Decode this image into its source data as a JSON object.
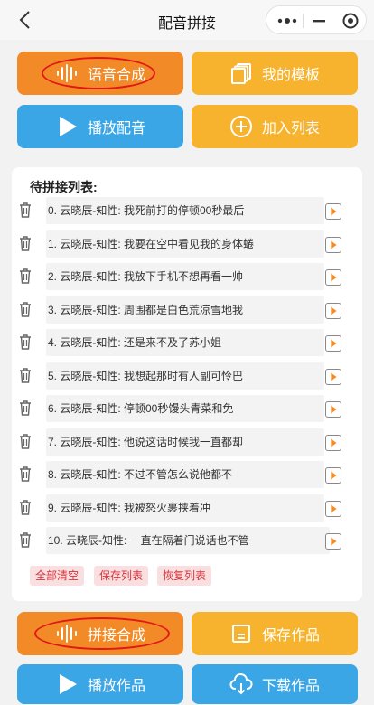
{
  "nav": {
    "title": "配音拼接"
  },
  "buttons": {
    "speech_synthesis": "语音合成",
    "my_templates": "我的模板",
    "play_dub": "播放配音",
    "add_to_list": "加入列表",
    "splice_synthesis": "拼接合成",
    "save_work": "保存作品",
    "play_work": "播放作品",
    "download_work": "下载作品"
  },
  "list": {
    "heading": "待拼接列表:",
    "items": [
      {
        "text": "0. 云晓辰-知性: 我死前打的停顿00秒最后"
      },
      {
        "text": "1. 云晓辰-知性: 我要在空中看见我的身体蜷"
      },
      {
        "text": "2. 云晓辰-知性: 我放下手机不想再看一帅"
      },
      {
        "text": "3. 云晓辰-知性: 周围都是白色荒凉雪地我"
      },
      {
        "text": "4. 云晓辰-知性: 还是来不及了苏小姐"
      },
      {
        "text": "5. 云晓辰-知性: 我想起那时有人副可怜巴"
      },
      {
        "text": "6. 云晓辰-知性: 停顿00秒馒头青菜和免"
      },
      {
        "text": "7. 云晓辰-知性: 他说这话时候我一直都却"
      },
      {
        "text": "8. 云晓辰-知性: 不过不管怎么说他都不"
      },
      {
        "text": "9. 云晓辰-知性: 我被怒火裹挟着冲"
      },
      {
        "text": "10. 云晓辰-知性: 一直在隔着门说话也不管"
      }
    ],
    "actions": {
      "clear_all": "全部清空",
      "save_list": "保存列表",
      "restore_list": "恢复列表"
    }
  },
  "colors": {
    "orange": "#f28a27",
    "yellow": "#f7b32d",
    "blue": "#3aa6e6",
    "annotation": "#e01818",
    "tag_text": "#d8343b"
  }
}
